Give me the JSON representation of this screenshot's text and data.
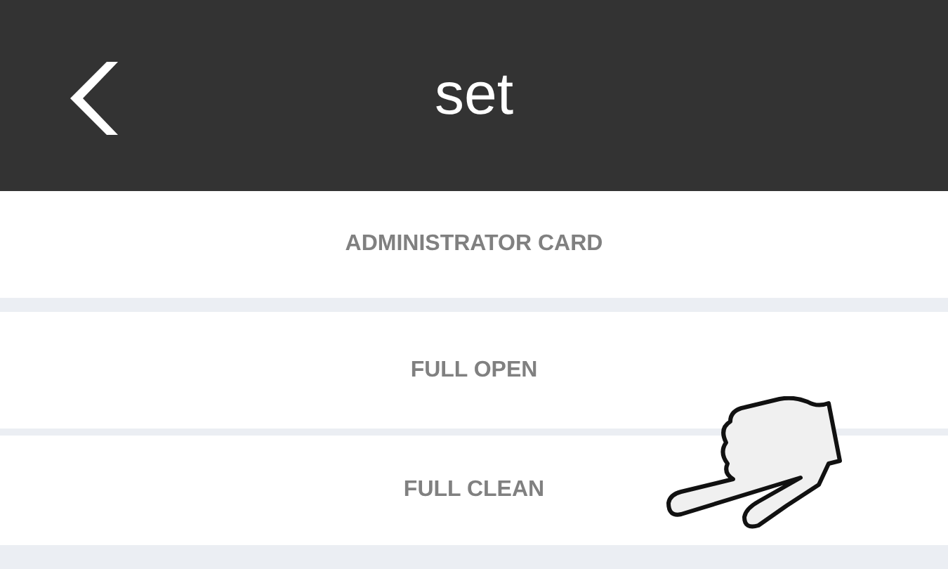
{
  "header": {
    "title": "set"
  },
  "menu_items": [
    {
      "label": "ADMINISTRATOR CARD"
    },
    {
      "label": "FULL OPEN"
    },
    {
      "label": "FULL CLEAN"
    }
  ]
}
